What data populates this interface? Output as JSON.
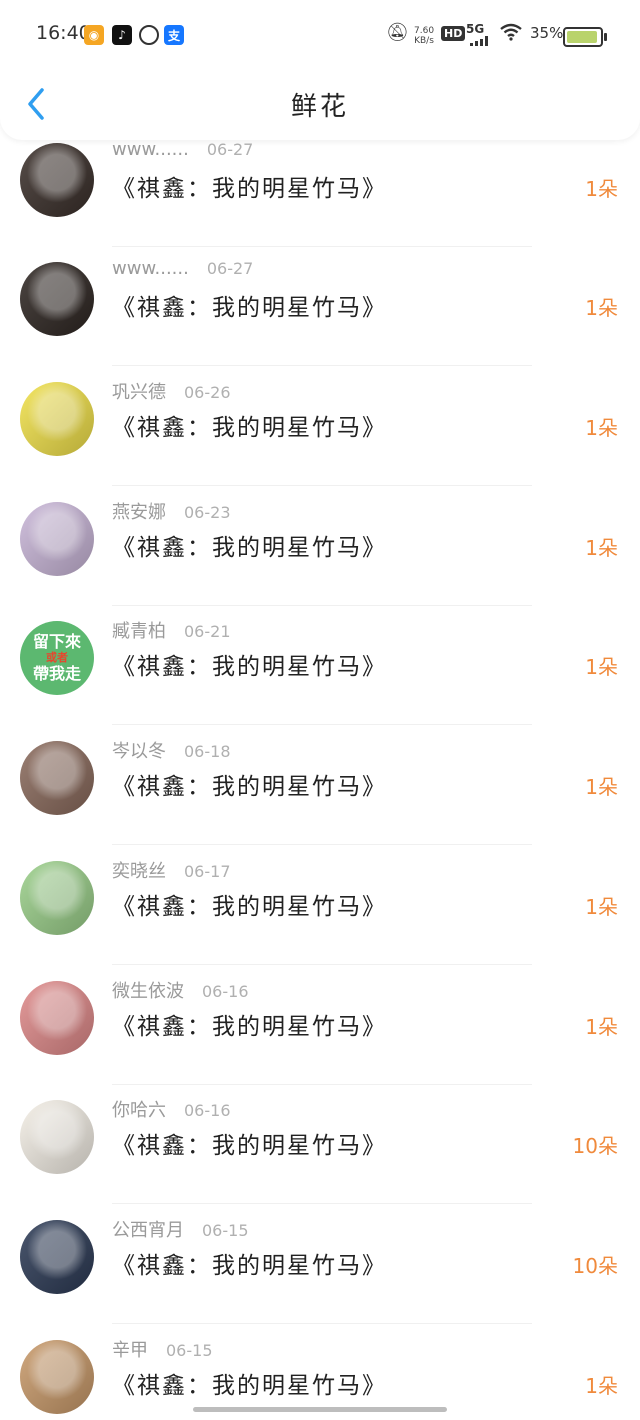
{
  "status_bar": {
    "time": "16:40",
    "net_speed_top": "7.60",
    "net_speed_bottom": "KB/s",
    "hd": "HD",
    "network": "5G",
    "battery_pct": "35%"
  },
  "header": {
    "title": "鲜花",
    "back_icon": "chevron-left-icon"
  },
  "rows": [
    {
      "name": "www......",
      "date": "06-27",
      "book": "《祺鑫：我的明星竹马》",
      "count": "1朵",
      "avatar_color": "#3a2f2a"
    },
    {
      "name": "www......",
      "date": "06-27",
      "book": "《祺鑫：我的明星竹马》",
      "count": "1朵",
      "avatar_color": "#2e2622"
    },
    {
      "name": "巩兴德",
      "date": "06-26",
      "book": "《祺鑫：我的明星竹马》",
      "count": "1朵",
      "avatar_color": "#f2e24a"
    },
    {
      "name": "燕安娜",
      "date": "06-23",
      "book": "《祺鑫：我的明星竹马》",
      "count": "1朵",
      "avatar_color": "#c9b6d8"
    },
    {
      "name": "臧青柏",
      "date": "06-21",
      "book": "《祺鑫：我的明星竹马》",
      "count": "1朵",
      "avatar_color": "#5cb870",
      "avatar_text": [
        "留下來",
        "或者",
        "帶我走"
      ]
    },
    {
      "name": "岑以冬",
      "date": "06-18",
      "book": "《祺鑫：我的明星竹马》",
      "count": "1朵",
      "avatar_color": "#8a6a5c"
    },
    {
      "name": "奕晓丝",
      "date": "06-17",
      "book": "《祺鑫：我的明星竹马》",
      "count": "1朵",
      "avatar_color": "#9bd08a"
    },
    {
      "name": "微生依波",
      "date": "06-16",
      "book": "《祺鑫：我的明星竹马》",
      "count": "1朵",
      "avatar_color": "#e08a8a"
    },
    {
      "name": "你哈六",
      "date": "06-16",
      "book": "《祺鑫：我的明星竹马》",
      "count": "10朵",
      "avatar_color": "#f4efe6"
    },
    {
      "name": "公西宵月",
      "date": "06-15",
      "book": "《祺鑫：我的明星竹马》",
      "count": "10朵",
      "avatar_color": "#2c3a55"
    },
    {
      "name": "辛甲",
      "date": "06-15",
      "book": "《祺鑫：我的明星竹马》",
      "count": "1朵",
      "avatar_color": "#c99a6a"
    }
  ]
}
